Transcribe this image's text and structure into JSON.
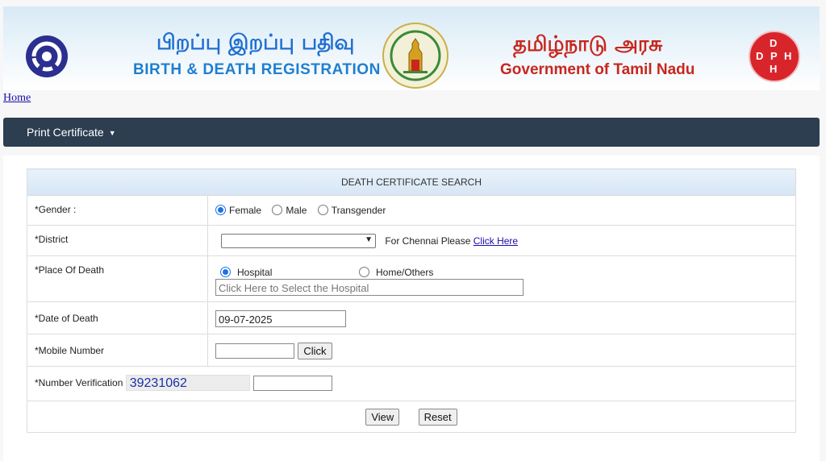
{
  "header": {
    "title_tamil": "பிறப்பு இறப்பு பதிவு",
    "title_english": "BIRTH & DEATH REGISTRATION",
    "gov_tamil": "தமிழ்நாடு அரசு",
    "gov_english": "Government of Tamil Nadu",
    "dph_letters": [
      "D",
      "D",
      "P",
      "H",
      "H"
    ]
  },
  "nav": {
    "home_link": "Home",
    "menu_item": "Print Certificate",
    "menu_caret": "▼"
  },
  "form": {
    "heading": "DEATH CERTIFICATE SEARCH",
    "gender": {
      "label": "*Gender :",
      "options": [
        "Female",
        "Male",
        "Transgender"
      ],
      "selected": "Female"
    },
    "district": {
      "label": "*District",
      "value": "",
      "chennai_text": "For Chennai Please",
      "chennai_link": "Click Here"
    },
    "place_of_death": {
      "label": "*Place Of Death",
      "options": [
        "Hospital",
        "Home/Others"
      ],
      "selected": "Hospital",
      "hospital_placeholder": "Click Here to Select the Hospital"
    },
    "date_of_death": {
      "label": "*Date of Death",
      "value": "09-07-2025"
    },
    "mobile": {
      "label": "*Mobile Number",
      "value": "",
      "button": "Click"
    },
    "verification": {
      "label": "*Number Verification",
      "captcha": "39231062",
      "value": ""
    },
    "buttons": {
      "view": "View",
      "reset": "Reset"
    }
  },
  "colors": {
    "navbar": "#2c3e50",
    "title_blue": "#1f6fd0",
    "gov_red": "#c8261e",
    "link": "#1a0dab"
  }
}
